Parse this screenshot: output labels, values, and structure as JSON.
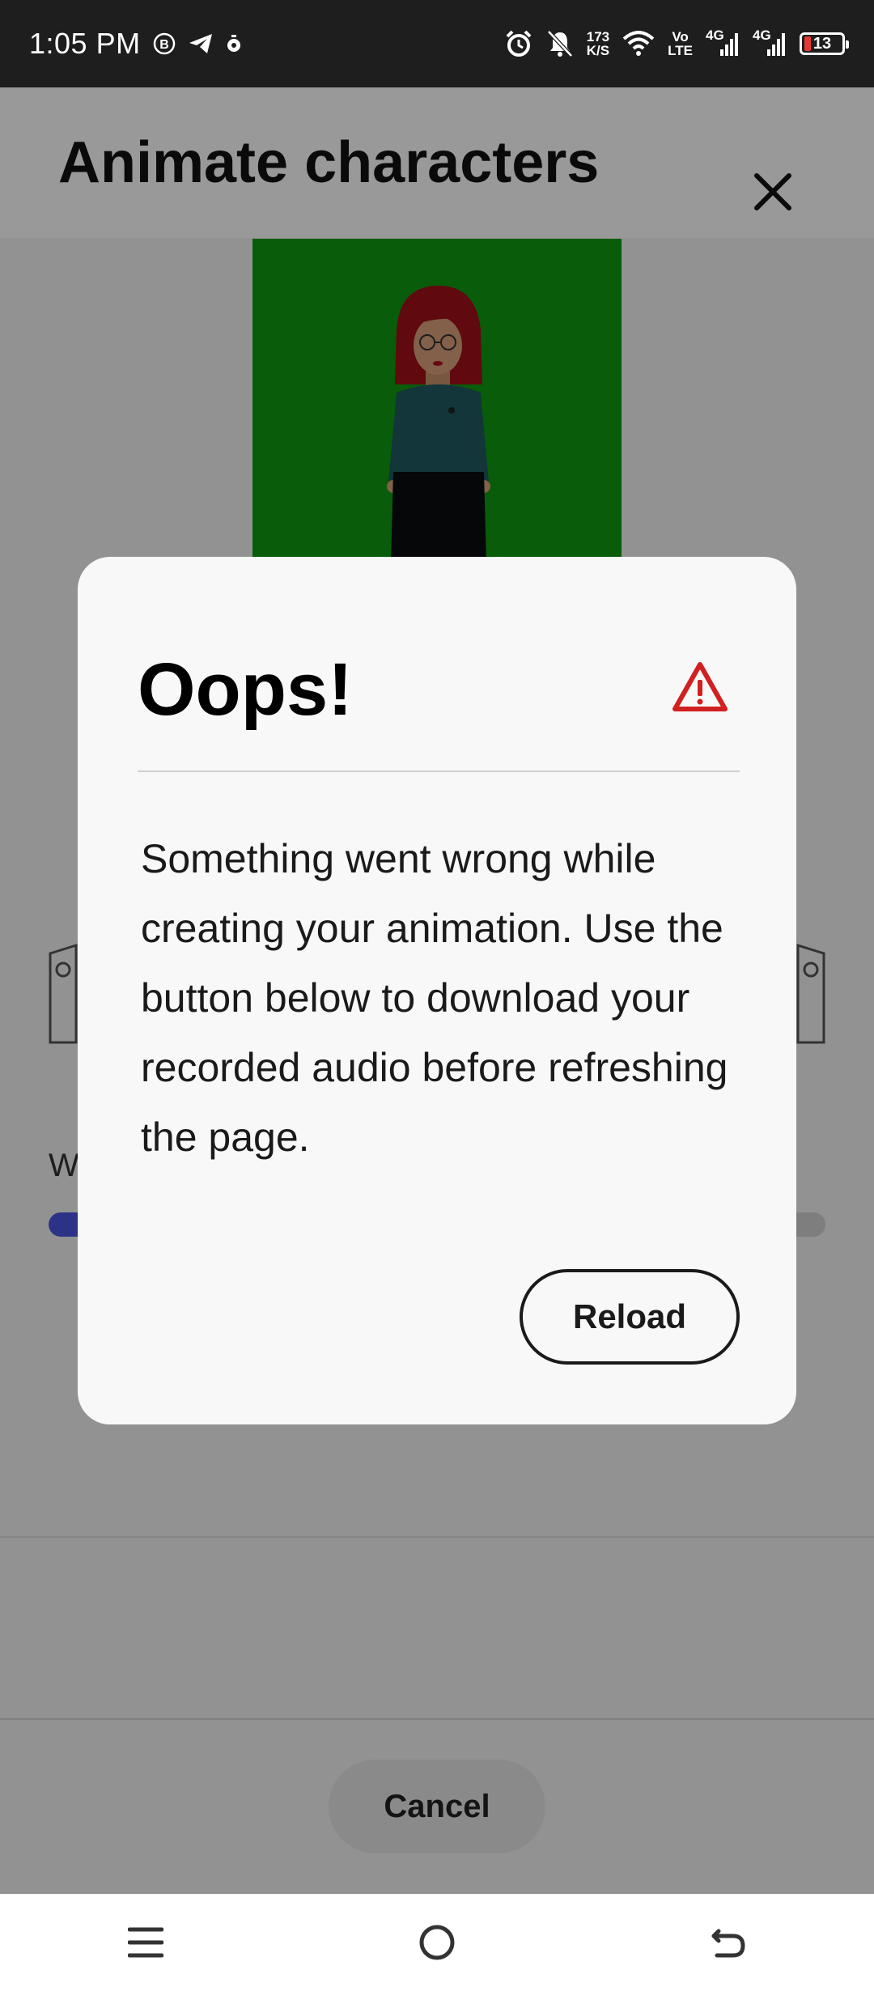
{
  "status_bar": {
    "time": "1:05 PM",
    "net_speed_top": "173",
    "net_speed_bottom": "K/S",
    "volte_top": "Vo",
    "volte_bottom": "LTE",
    "sim1_label": "4G",
    "sim2_label": "4G",
    "battery_level": "13",
    "icons": [
      "b-icon",
      "telegram-icon",
      "timer-icon",
      "alarm-icon",
      "bell-off-icon",
      "wifi-icon",
      "signal-icon",
      "battery-icon"
    ]
  },
  "header": {
    "title": "Animate characters"
  },
  "background": {
    "partial_label": "W",
    "progress": 0.05,
    "progress_color": "#4a56e2",
    "preview_color": "#0f9a0f"
  },
  "footer": {
    "cancel_label": "Cancel"
  },
  "dialog": {
    "title": "Oops!",
    "message": "Something went wrong while creating your animation. Use the button below to download your recorded audio before refreshing the page.",
    "reload_label": "Reload",
    "alert_color": "#d0201f"
  },
  "nav": {
    "icons": [
      "menu-icon",
      "home-icon",
      "back-icon"
    ]
  }
}
